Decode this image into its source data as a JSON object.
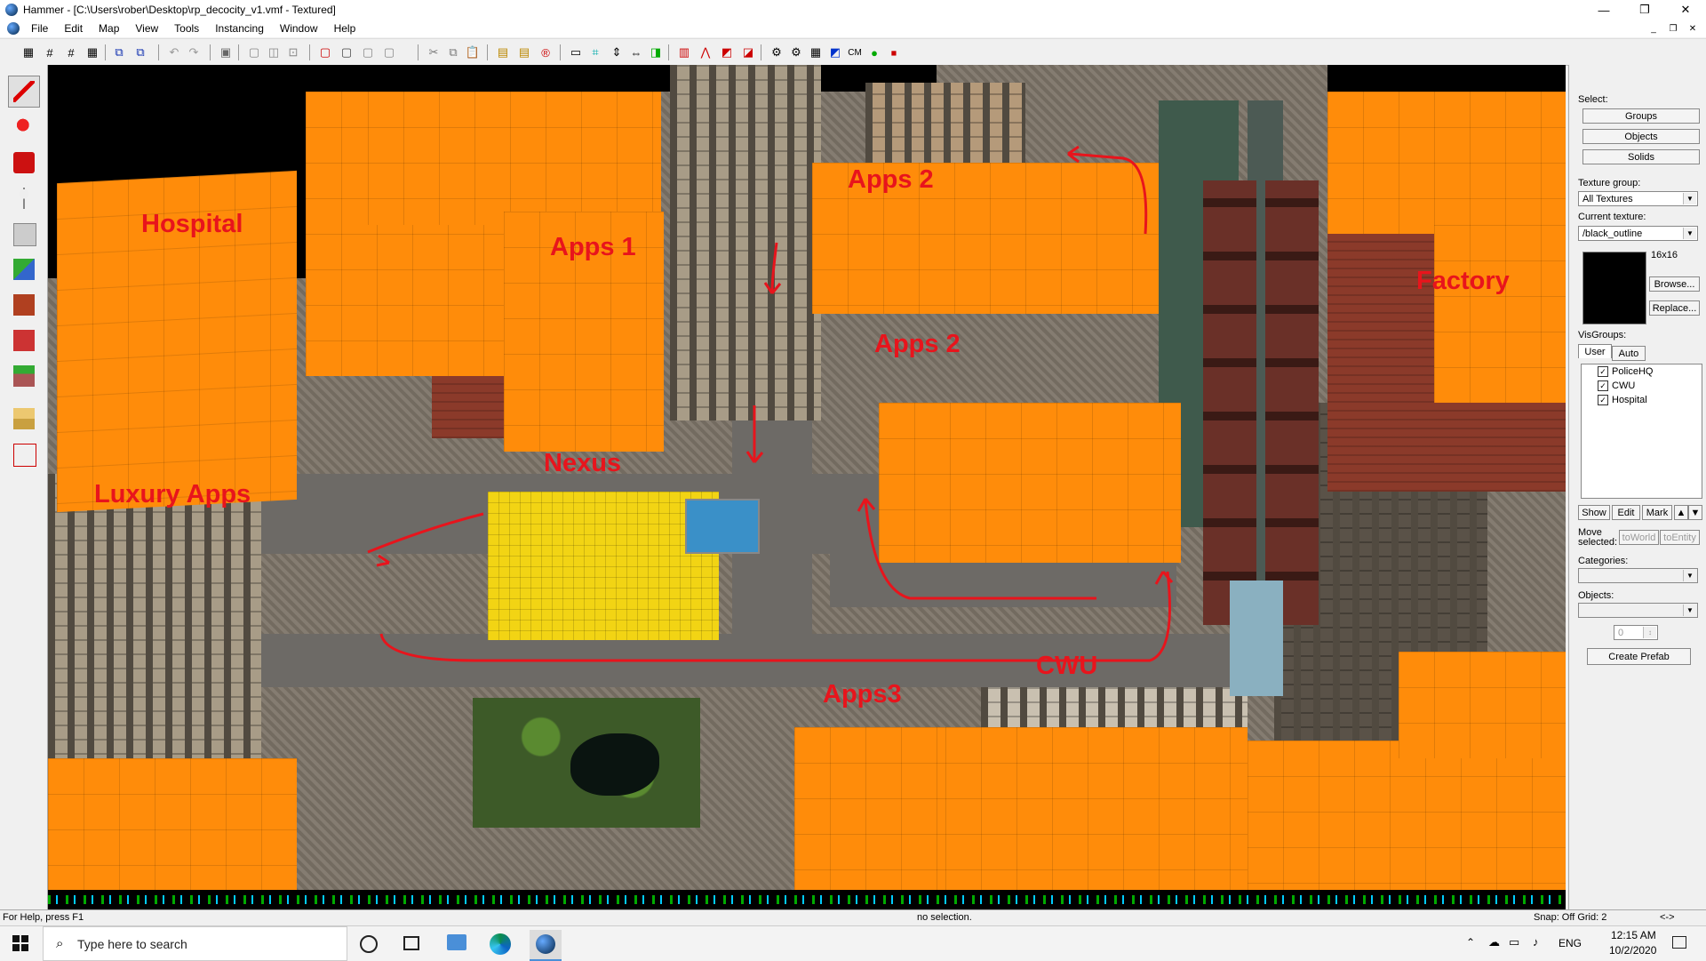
{
  "window": {
    "title": "Hammer - [C:\\Users\\rober\\Desktop\\rp_decocity_v1.vmf - Textured]",
    "controls": [
      "—",
      "❐",
      "✕"
    ]
  },
  "menu": [
    "File",
    "Edit",
    "Map",
    "View",
    "Tools",
    "Instancing",
    "Window",
    "Help"
  ],
  "mdi_controls": [
    "_",
    "❐",
    "✕"
  ],
  "toolbar": {
    "cm_label": "CM"
  },
  "map_labels": {
    "hospital": "Hospital",
    "apps1": "Apps 1",
    "apps2_top": "Apps 2",
    "apps2_mid": "Apps 2",
    "factory": "Factory",
    "nexus": "Nexus",
    "luxury": "Luxury Apps",
    "cwu": "CWU",
    "apps3": "Apps3"
  },
  "right_panel": {
    "select_label": "Select:",
    "groups": "Groups",
    "objects": "Objects",
    "solids": "Solids",
    "texture_group_label": "Texture group:",
    "texture_group_value": "All Textures",
    "current_texture_label": "Current texture:",
    "current_texture_value": "/black_outline",
    "texture_size": "16x16",
    "browse": "Browse...",
    "replace": "Replace...",
    "visgroups_label": "VisGroups:",
    "tab_user": "User",
    "tab_auto": "Auto",
    "visgroups": [
      "PoliceHQ",
      "CWU",
      "Hospital"
    ],
    "show": "Show",
    "edit": "Edit",
    "mark": "Mark",
    "move_selected": "Move selected:",
    "to_world": "toWorld",
    "to_entity": "toEntity",
    "categories_label": "Categories:",
    "objects_label": "Objects:",
    "count_value": "0",
    "create_prefab": "Create Prefab"
  },
  "status": {
    "help": "For Help, press F1",
    "selection": "no selection.",
    "snap": "Snap: Off Grid: 2",
    "arrows": "<->"
  },
  "taskbar": {
    "search_placeholder": "Type here to search",
    "language": "ENG",
    "time": "12:15 AM",
    "date": "10/2/2020"
  }
}
